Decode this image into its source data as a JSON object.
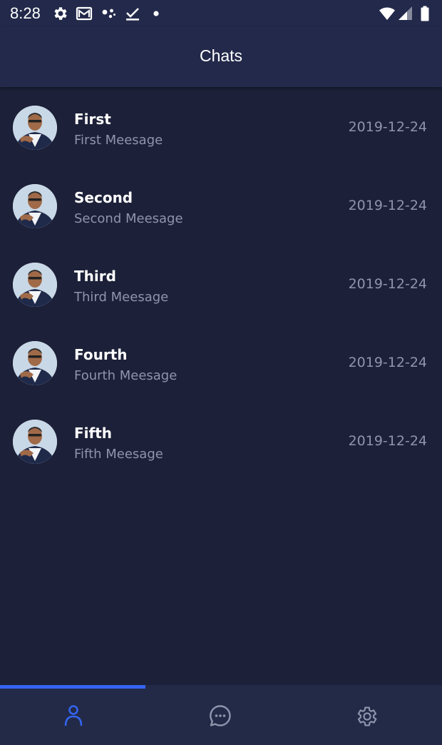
{
  "status_bar": {
    "time": "8:28",
    "left_icons": [
      "gear-icon",
      "gmail-icon",
      "dots-icon",
      "download-done-icon",
      "notification-dot-icon"
    ],
    "right_icons": [
      "wifi-icon",
      "signal-icon",
      "battery-icon"
    ]
  },
  "app_bar": {
    "title": "Chats"
  },
  "chats": [
    {
      "name": "First",
      "message": "First Meesage",
      "date": "2019-12-24"
    },
    {
      "name": "Second",
      "message": "Second Meesage",
      "date": "2019-12-24"
    },
    {
      "name": "Third",
      "message": "Third Meesage",
      "date": "2019-12-24"
    },
    {
      "name": "Fourth",
      "message": "Fourth Meesage",
      "date": "2019-12-24"
    },
    {
      "name": "Fifth",
      "message": "Fifth Meesage",
      "date": "2019-12-24"
    }
  ],
  "bottom_nav": {
    "tabs": [
      {
        "icon": "person-icon",
        "active": true
      },
      {
        "icon": "chat-bubble-icon",
        "active": false
      },
      {
        "icon": "settings-gear-icon",
        "active": false
      }
    ],
    "active_color": "#3564f0",
    "inactive_color": "#8e95ad"
  },
  "colors": {
    "background": "#1c2038",
    "app_bar": "#22294a",
    "secondary_text": "#8e95ad"
  }
}
